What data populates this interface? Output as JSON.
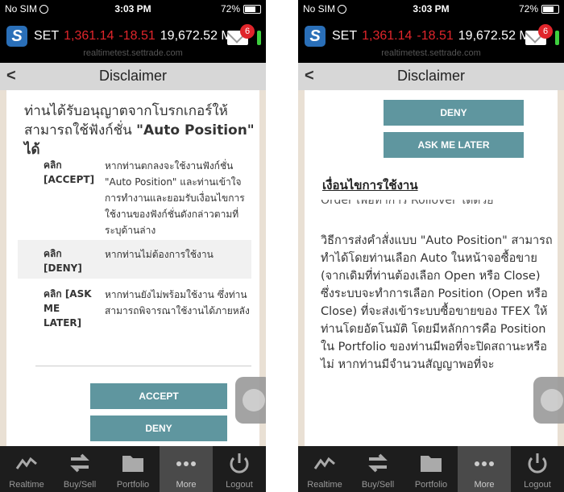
{
  "status": {
    "carrier": "No SIM",
    "time": "3:03 PM",
    "battery": "72%"
  },
  "ticker": {
    "logo": "S",
    "symbol": "SET",
    "index": "1,361.14",
    "change": "-18.51",
    "volume": "19,672.52 M",
    "domain": "realtimetest.settrade.com",
    "badge": "6"
  },
  "nav": {
    "back": "<",
    "title": "Disclaimer"
  },
  "left": {
    "heading_pre": "ท่านได้รับอนุญาตจากโบรกเกอร์ให้สามารถใช้ฟังก์ชั่น ",
    "heading_bold": "\"Auto Position\" ได้",
    "options": [
      {
        "key": "คลิก [ACCEPT]",
        "desc": "หากท่านตกลงจะใช้งานฟังก์ชั่น \"Auto Position\" และท่านเข้าใจการทำงานและยอมรับเงื่อนไขการใช้งานของฟังก์ชั่นดังกล่าวตามที่ระบุด้านล่าง"
      },
      {
        "key": "คลิก [DENY]",
        "desc": "หากท่านไม่ต้องการใช้งาน"
      },
      {
        "key": "คลิก [ASK ME LATER]",
        "desc": "หากท่านยังไม่พร้อมใช้งาน ซึ่งท่านสามารถพิจารณาใช้งานได้ภายหลัง"
      }
    ],
    "accept_label": "ACCEPT",
    "deny_label": "DENY"
  },
  "right": {
    "deny_label": "DENY",
    "later_label": "ASK ME LATER",
    "terms_heading": "เงื่อนไขการใช้งาน",
    "cut_line": "Order เพื่อทำการ Rollover ได้ด้วย",
    "terms_body": "วิธีการส่งคำสั่งแบบ \"Auto Position\" สามารถทำได้โดยท่านเลือก Auto ในหน้าจอซื้อขาย (จากเดิมที่ท่านต้องเลือก Open หรือ Close) ซึ่งระบบจะทำการเลือก Position (Open หรือ Close) ที่จะส่งเข้าระบบซื้อขายของ TFEX ให้ท่านโดยอัตโนมัติ โดยมีหลักการคือ Position ใน Portfolio ของท่านมีพอที่จะปิดสถานะหรือไม่ หากท่านมีจำนวนสัญญาพอที่จะ"
  },
  "tabs": [
    {
      "label": "Realtime",
      "icon": "realtime-chart-icon"
    },
    {
      "label": "Buy/Sell",
      "icon": "buy-sell-arrows-icon"
    },
    {
      "label": "Portfolio",
      "icon": "portfolio-folder-icon"
    },
    {
      "label": "More",
      "icon": "more-dots-icon",
      "active": true
    },
    {
      "label": "Logout",
      "icon": "power-icon"
    }
  ],
  "colors": {
    "accent_button": "#5f969f",
    "ticker_red": "#e0252b",
    "tab_bg": "#1d1d1d",
    "content_bg": "#e9e0d4"
  }
}
